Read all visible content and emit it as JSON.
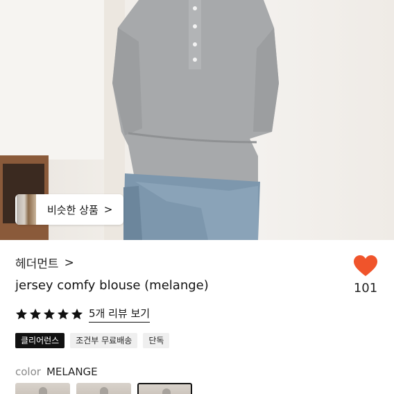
{
  "hero": {
    "similar_button_label": "비슷한 상품",
    "similar_button_chevron": ">"
  },
  "product": {
    "brand": "헤더먼트",
    "brand_chevron": ">",
    "title": "jersey comfy blouse (melange)",
    "like_count": "101",
    "like_color": "#f0542b",
    "rating_stars": 5,
    "review_link": "5개 리뷰 보기",
    "badges": [
      "클리어런스",
      "조건부 무료배송",
      "단독"
    ],
    "color_label": "color",
    "color_value": "MELANGE",
    "swatch_count": 3,
    "selected_swatch": 3
  }
}
